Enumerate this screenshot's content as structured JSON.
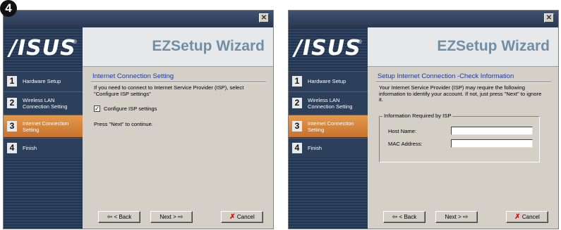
{
  "figure_step": "4",
  "wizards": [
    {
      "logo": "/ISUS",
      "title": "EZSetup Wizard",
      "steps": [
        {
          "num": "1",
          "label": "Hardware Setup",
          "active": false
        },
        {
          "num": "2",
          "label": "Wireless LAN Connection Setting",
          "active": false
        },
        {
          "num": "3",
          "label": "Internet Connection Setting",
          "active": true
        },
        {
          "num": "4",
          "label": "Finish",
          "active": false
        }
      ],
      "section_title": "Internet Connection Setting",
      "paragraph": "If you need to connect to Internet Service Provider (ISP), select \"Configure ISP settings\"",
      "checkbox": {
        "label": "Configure ISP settings",
        "checked": true
      },
      "continue_text": "Press \"Next\" to continue.",
      "buttons": {
        "back": "< Back",
        "next": "Next >",
        "cancel": "Cancel"
      }
    },
    {
      "logo": "/ISUS",
      "title": "EZSetup Wizard",
      "steps": [
        {
          "num": "1",
          "label": "Hardware Setup",
          "active": false
        },
        {
          "num": "2",
          "label": "Wireless LAN Connection Setting",
          "active": false
        },
        {
          "num": "3",
          "label": "Internet Connection Setting",
          "active": true
        },
        {
          "num": "4",
          "label": "Finish",
          "active": false
        }
      ],
      "section_title": "Setup Internet Connection -Check Information",
      "paragraph": "Your Internet Service Provider (ISP) may require the following information to identify your account. If not, just press \"Next\" to ignore it.",
      "group_title": "Information Required by ISP",
      "fields": [
        {
          "label": "Host Name:",
          "value": ""
        },
        {
          "label": "MAC Address:",
          "value": ""
        }
      ],
      "buttons": {
        "back": "< Back",
        "next": "Next >",
        "cancel": "Cancel"
      }
    }
  ]
}
